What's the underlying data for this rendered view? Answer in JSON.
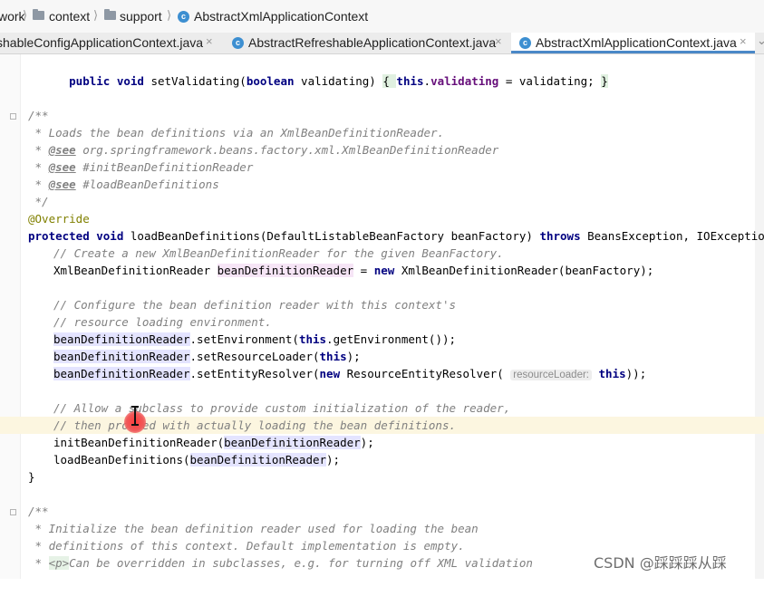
{
  "breadcrumb": {
    "items": [
      "work",
      "context",
      "support",
      "AbstractXmlApplicationContext"
    ],
    "class_icon_letter": "c"
  },
  "tabs": [
    {
      "label": "shableConfigApplicationContext.java",
      "close": "×"
    },
    {
      "label": "AbstractRefreshableApplicationContext.java",
      "close": "×"
    },
    {
      "label": "AbstractXmlApplicationContext.java",
      "close": "×"
    }
  ],
  "tabs_overflow": "⌄",
  "code": {
    "l0": {
      "a": "public void ",
      "b": "setValidating(",
      "c": "boolean ",
      "d": "validating) ",
      "e": "{ ",
      "f": "this",
      "g": ".",
      "h": "validating",
      "i": " = validating; ",
      "j": "}"
    },
    "l3": "/**",
    "l4": " * Loads the bean definitions via an XmlBeanDefinitionReader.",
    "l5": {
      "a": " * ",
      "b": "@see",
      "c": " org.springframework.beans.factory.xml.XmlBeanDefinitionReader"
    },
    "l6": {
      "a": " * ",
      "b": "@see",
      "c": " #initBeanDefinitionReader"
    },
    "l7": {
      "a": " * ",
      "b": "@see",
      "c": " #loadBeanDefinitions"
    },
    "l8": " */",
    "l9": "@Override",
    "l10": {
      "a": "protected void ",
      "b": "loadBeanDefinitions(DefaultListableBeanFactory beanFactory) ",
      "c": "throws ",
      "d": "BeansException, IOException {"
    },
    "l11": "// Create a new XmlBeanDefinitionReader for the given BeanFactory.",
    "l12": {
      "a": "XmlBeanDefinitionReader ",
      "b": "beanDefinitionReader",
      "c": " = ",
      "d": "new ",
      "e": "XmlBeanDefinitionReader(beanFactory);"
    },
    "l14": "// Configure the bean definition reader with this context's",
    "l15": "// resource loading environment.",
    "l16": {
      "a": "beanDefinitionReader",
      "b": ".setEnvironment(",
      "c": "this",
      "d": ".getEnvironment());"
    },
    "l17": {
      "a": "beanDefinitionReader",
      "b": ".setResourceLoader(",
      "c": "this",
      "d": ");"
    },
    "l18": {
      "a": "beanDefinitionReader",
      "b": ".setEntityResolver(",
      "c": "new ",
      "d": "ResourceEntityResolver( ",
      "hint": "resourceLoader:",
      "e": " ",
      "f": "this",
      "g": "));"
    },
    "l20": "// Allow a subclass to provide custom initialization of the reader,",
    "l21": "// then proceed with actually loading the bean definitions.",
    "l22": {
      "a": "initBeanDefinitionReader(",
      "b": "beanDefinitionReader",
      "c": ");"
    },
    "l23": {
      "a": "loadBeanDefinitions(",
      "b": "beanDefinitionReader",
      "c": ");"
    },
    "l24": "}",
    "l26": "/**",
    "l27": " * Initialize the bean definition reader used for loading the bean",
    "l28": " * definitions of this context. Default implementation is empty.",
    "l29": {
      "a": " * ",
      "b": "<p>",
      "c": "Can be overridden in subclasses, e.g. for turning off XML validation"
    }
  },
  "watermark": "CSDN @踩踩踩从踩"
}
